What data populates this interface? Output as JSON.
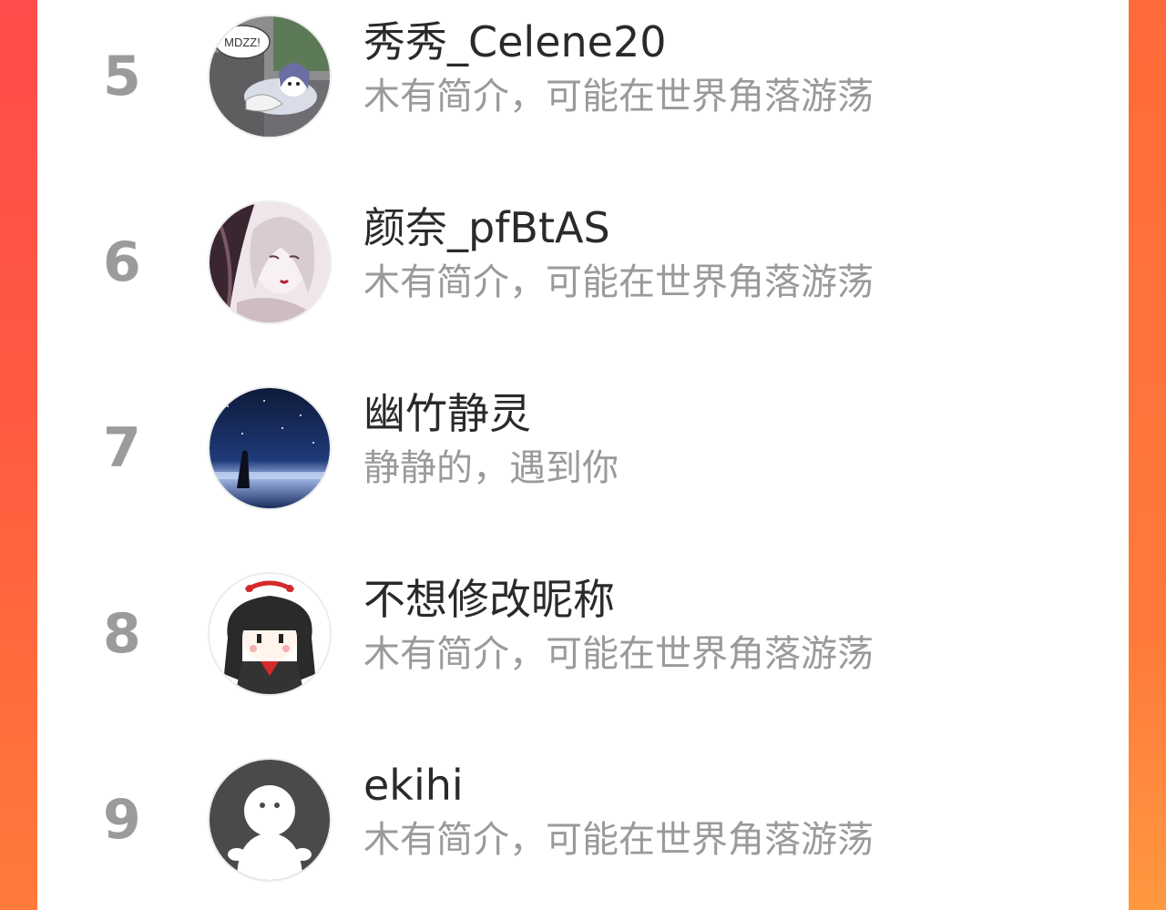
{
  "ranking": {
    "items": [
      {
        "rank": "5",
        "name": "秀秀_Celene20",
        "bio": "木有简介，可能在世界角落游荡",
        "avatar": "anime-girl-avatar"
      },
      {
        "rank": "6",
        "name": "颜奈_pfBtAS",
        "bio": "木有简介，可能在世界角落游荡",
        "avatar": "illustrated-portrait-avatar"
      },
      {
        "rank": "7",
        "name": "幽竹静灵",
        "bio": "静静的，遇到你",
        "avatar": "night-sky-silhouette-avatar"
      },
      {
        "rank": "8",
        "name": "不想修改昵称",
        "bio": "木有简介，可能在世界角落游荡",
        "avatar": "chibi-girl-avatar"
      },
      {
        "rank": "9",
        "name": "ekihi",
        "bio": "木有简介，可能在世界角落游荡",
        "avatar": "default-user-avatar"
      }
    ]
  },
  "avatar_text": {
    "bubble": "MDZZ!"
  },
  "colors": {
    "background_left": "#ff4b4b",
    "background_right": "#ff7a3a",
    "panel": "#ffffff",
    "rank_text": "#9b9b9b",
    "name_text": "#2a2a2a",
    "bio_text": "#9a9a9a"
  }
}
